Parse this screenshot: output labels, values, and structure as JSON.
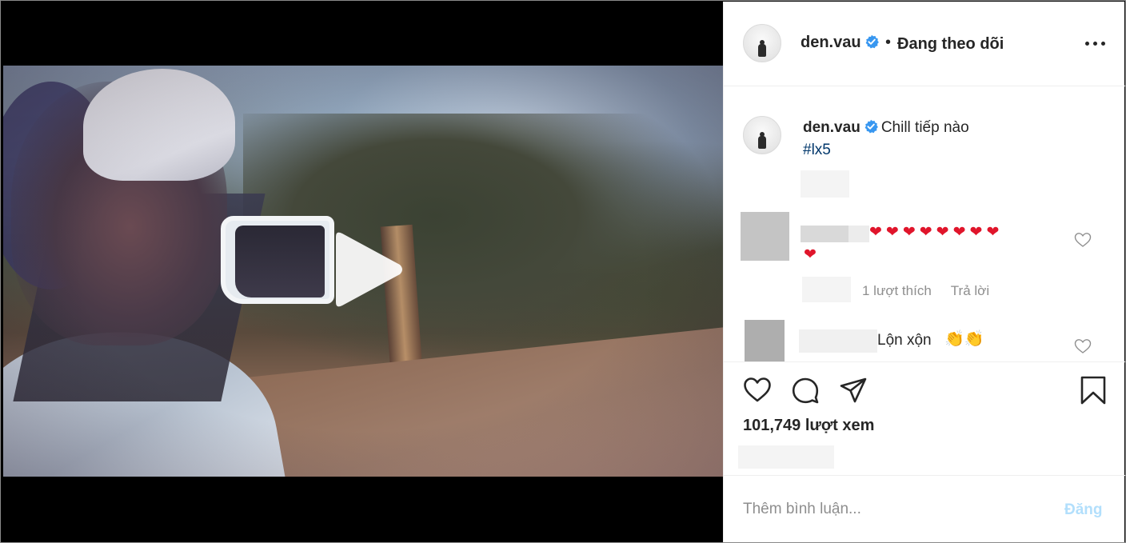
{
  "post": {
    "username": "den.vau",
    "verified": true,
    "follow_status": "Đang theo dõi",
    "separator": "•"
  },
  "caption": {
    "username": "den.vau",
    "text": "Chill tiếp nào",
    "hashtag": "#lx5"
  },
  "comments": [
    {
      "text_hearts_row1": "❤❤❤❤❤❤❤❤",
      "text_hearts_row2": "❤",
      "likes_label": "1 lượt thích",
      "reply_label": "Trả lời"
    },
    {
      "text": "Lộn xộn",
      "emoji": "👏👏"
    }
  ],
  "stats": {
    "views": "101,749 lượt xem"
  },
  "add_comment": {
    "placeholder": "Thêm bình luận...",
    "post_label": "Đăng"
  },
  "icons": {
    "play": "play-icon",
    "more": "more-options-icon",
    "verified": "verified-badge-icon",
    "like": "heart-icon",
    "comment": "comment-bubble-icon",
    "share": "paper-plane-icon",
    "save": "bookmark-icon"
  },
  "colors": {
    "verified_blue": "#3897f0",
    "heart_red": "#e0152b",
    "hashtag_blue": "#00376b",
    "muted_gray": "#8e8e8e",
    "post_disabled_blue": "#b2dffc"
  }
}
